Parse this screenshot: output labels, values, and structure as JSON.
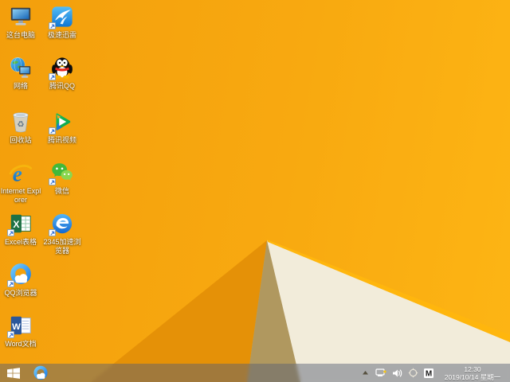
{
  "wallpaper": {
    "base_color": "#f7a60f",
    "base_bright_color": "#fdb514",
    "fold_shadow_orange": "#e59107",
    "fold_shadow_tan": "#b0985f",
    "fold_cream": "#f2ecda",
    "fold_highlight": "#ffb60d"
  },
  "desktop": {
    "icons": [
      {
        "id": "this-pc",
        "label": "这台电脑",
        "shortcut": false
      },
      {
        "id": "thunder-speed",
        "label": "极速迅雷",
        "shortcut": true
      },
      {
        "id": "network",
        "label": "网络",
        "shortcut": false
      },
      {
        "id": "tencent-qq",
        "label": "腾讯QQ",
        "shortcut": true
      },
      {
        "id": "recycle-bin",
        "label": "回收站",
        "shortcut": false
      },
      {
        "id": "tencent-video",
        "label": "腾讯视频",
        "shortcut": true
      },
      {
        "id": "internet-explorer",
        "label": "Internet Explorer",
        "shortcut": false
      },
      {
        "id": "wechat",
        "label": "微信",
        "shortcut": true
      },
      {
        "id": "excel",
        "label": "Excel表格",
        "shortcut": true
      },
      {
        "id": "browser-2345",
        "label": "2345加速浏览器",
        "shortcut": true
      },
      {
        "id": "qq-browser",
        "label": "QQ浏览器",
        "shortcut": true
      },
      {
        "id": "word",
        "label": "Word文档",
        "shortcut": true
      }
    ]
  },
  "taskbar": {
    "start": {
      "id": "start-button"
    },
    "pinned": [
      {
        "id": "qq-browser",
        "title": "QQ浏览器"
      }
    ],
    "tray": {
      "icons": [
        "show-hidden-icons",
        "network-status",
        "volume",
        "input-indicator",
        "ime-mode"
      ],
      "ime_letter": "M",
      "clock": {
        "time": "12:30",
        "date": "2019/10/14 星期一"
      }
    }
  }
}
